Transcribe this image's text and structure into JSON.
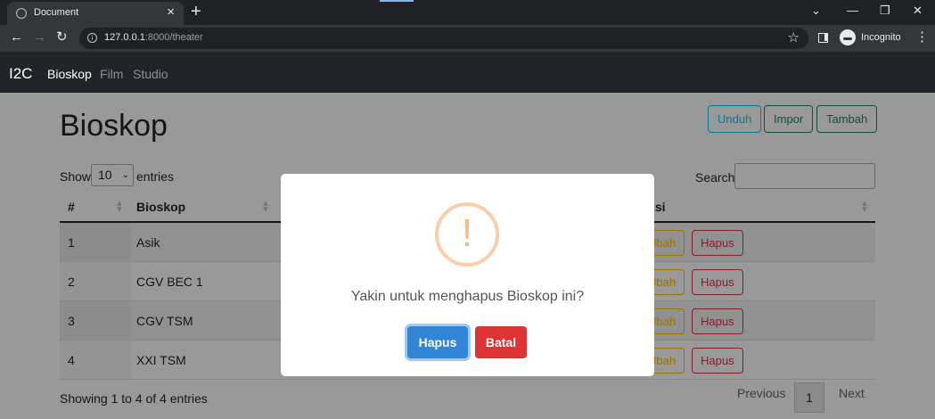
{
  "browser": {
    "tab_title": "Document",
    "new_tab": "+",
    "url_host": "127.0.0.1",
    "url_rest": ":8000/theater",
    "incognito_label": "Incognito"
  },
  "navbar": {
    "brand": "I2C",
    "links": [
      "Bioskop",
      "Film",
      "Studio"
    ]
  },
  "page": {
    "title": "Bioskop",
    "actions": {
      "download": "Unduh",
      "import": "Impor",
      "add": "Tambah"
    },
    "length": {
      "show": "Show",
      "value": "10",
      "entries": "entries"
    },
    "search_label": "Search:",
    "table": {
      "headers": [
        "#",
        "Bioskop",
        "Aksi"
      ],
      "rows": [
        {
          "num": "1",
          "name": "Asik"
        },
        {
          "num": "2",
          "name": "CGV BEC 1"
        },
        {
          "num": "3",
          "name": "CGV TSM"
        },
        {
          "num": "4",
          "name": "XXI TSM"
        }
      ],
      "edit_label": "Ubah",
      "delete_label": "Hapus"
    },
    "info": "Showing 1 to 4 of 4 entries",
    "pagination": {
      "previous": "Previous",
      "current": "1",
      "next": "Next"
    }
  },
  "modal": {
    "icon": "!",
    "message": "Yakin untuk menghapus Bioskop ini?",
    "confirm": "Hapus",
    "cancel": "Batal"
  },
  "colors": {
    "confirm": "#3085d6",
    "cancel": "#dd3333",
    "warning_icon": "#f8bb86"
  }
}
